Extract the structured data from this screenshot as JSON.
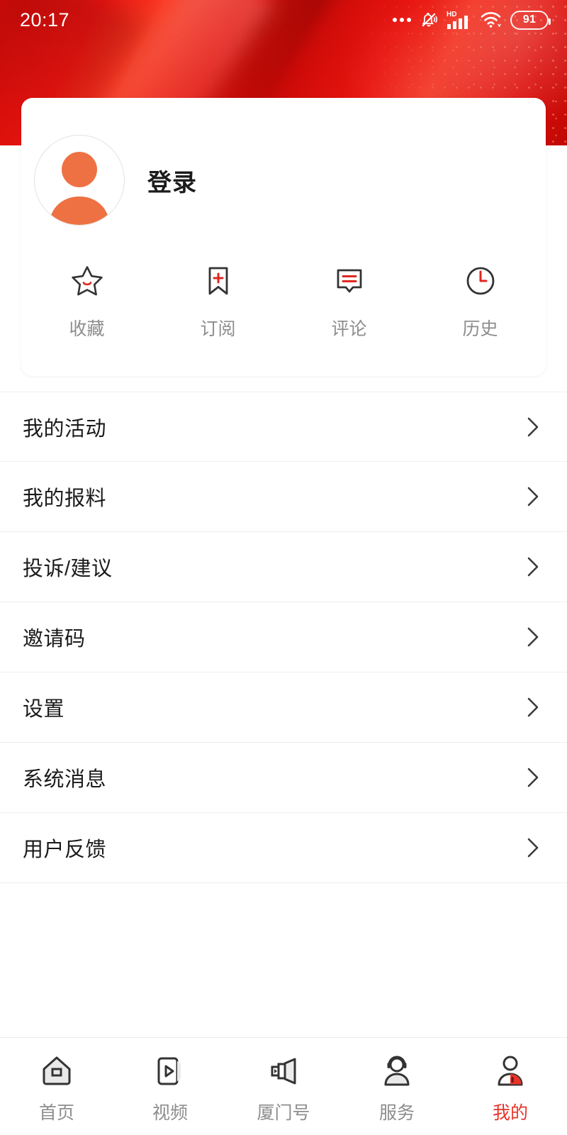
{
  "status_bar": {
    "time": "20:17",
    "battery_level": "91",
    "icons": [
      "more-dots-icon",
      "bell-muted-icon",
      "hd-icon",
      "signal-bars-icon",
      "wifi-icon",
      "battery-icon"
    ]
  },
  "theme": {
    "brand_red": "#e8342a",
    "header_red": "#e21109",
    "accent_orange": "#ee7143",
    "icon_dark": "#333333",
    "muted_text": "#8d8d8d",
    "primary_text": "#1b1b1b"
  },
  "profile": {
    "avatar_icon": "user-avatar-icon",
    "login_label": "登录"
  },
  "quick_actions": [
    {
      "label": "收藏",
      "icon": "star-icon"
    },
    {
      "label": "订阅",
      "icon": "bookmark-plus-icon"
    },
    {
      "label": "评论",
      "icon": "comment-bubble-icon"
    },
    {
      "label": "历史",
      "icon": "clock-icon"
    }
  ],
  "menu_items": [
    {
      "label": "我的活动",
      "chevron": "chevron-right-icon"
    },
    {
      "label": "我的报料",
      "chevron": "chevron-right-icon"
    },
    {
      "label": "投诉/建议",
      "chevron": "chevron-right-icon"
    },
    {
      "label": "邀请码",
      "chevron": "chevron-right-icon"
    },
    {
      "label": "设置",
      "chevron": "chevron-right-icon"
    },
    {
      "label": "系统消息",
      "chevron": "chevron-right-icon"
    },
    {
      "label": "用户反馈",
      "chevron": "chevron-right-icon"
    }
  ],
  "tab_bar": [
    {
      "label": "首页",
      "icon": "home-icon",
      "active": false
    },
    {
      "label": "视频",
      "icon": "video-icon",
      "active": false
    },
    {
      "label": "厦门号",
      "icon": "megaphone-icon",
      "active": false
    },
    {
      "label": "服务",
      "icon": "headset-person-icon",
      "active": false
    },
    {
      "label": "我的",
      "icon": "person-icon",
      "active": true
    }
  ]
}
